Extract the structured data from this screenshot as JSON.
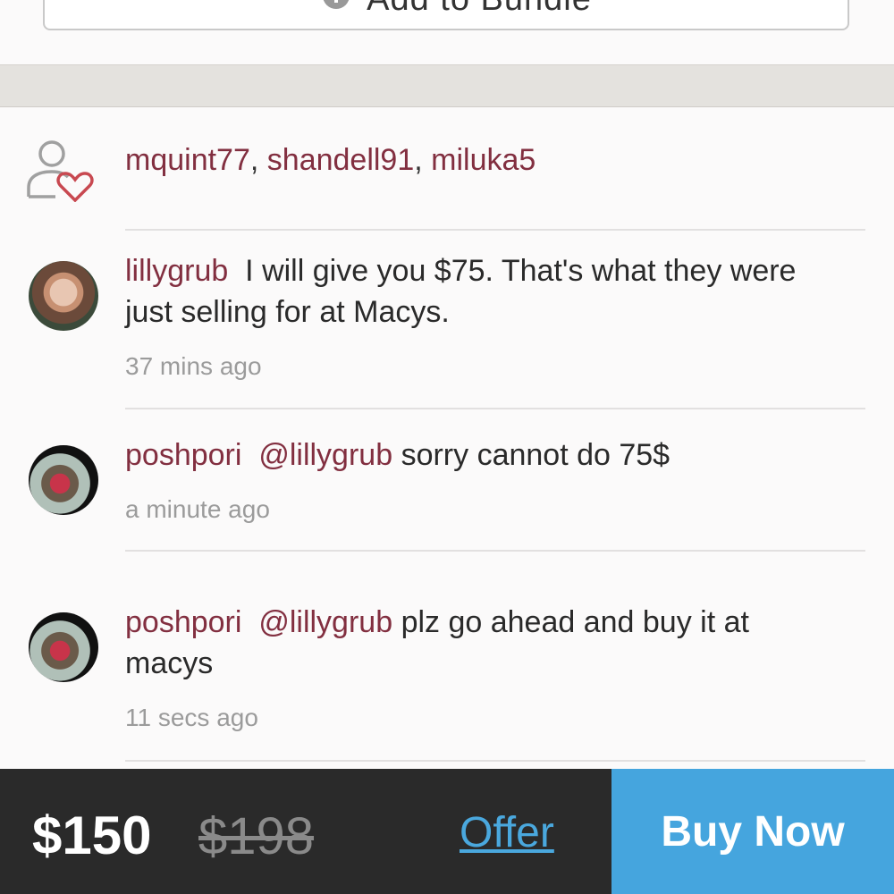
{
  "bundle": {
    "label": "Add to Bundle",
    "icon": "add-to-bundle-icon"
  },
  "likes": {
    "icon": "likes-heart-person-icon",
    "users": [
      "mquint77",
      "shandell91",
      "miluka5"
    ],
    "separator": ", "
  },
  "comments": [
    {
      "user": "lillygrub",
      "mention": "",
      "text": "I will give you $75. That's what they were just selling for at Macys.",
      "time": "37 mins ago"
    },
    {
      "user": "poshpori",
      "mention": "@lillygrub",
      "text": "sorry cannot do 75$",
      "time": "a minute ago"
    },
    {
      "user": "poshpori",
      "mention": "@lillygrub",
      "text": "plz go ahead and buy it at macys",
      "time": "11 secs ago"
    }
  ],
  "footer": {
    "price": "$150",
    "original_price": "$198",
    "offer_label": "Offer",
    "buy_label": "Buy Now"
  },
  "colors": {
    "username": "#822f40",
    "accent_blue": "#45a5de",
    "footer_bg": "#2a2a2a"
  }
}
